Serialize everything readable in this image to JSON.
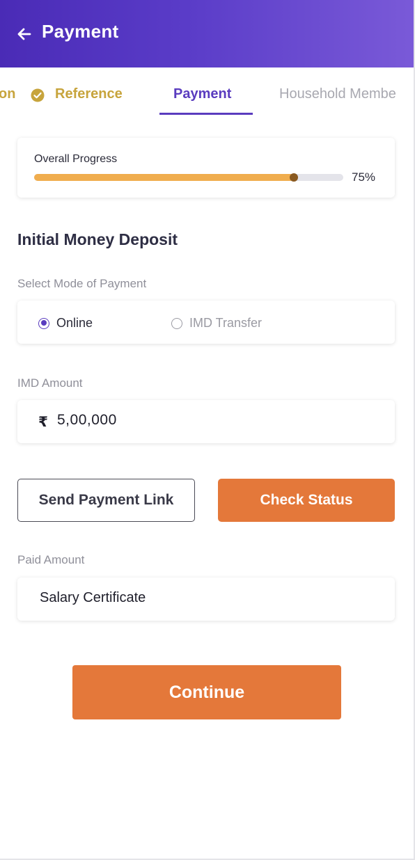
{
  "header": {
    "title": "Payment",
    "gradient_start": "#4a2bb6",
    "gradient_end": "#7a5ad8"
  },
  "tabs": [
    {
      "label": "on",
      "state": "done"
    },
    {
      "label": "Reference",
      "state": "done"
    },
    {
      "label": "Payment",
      "state": "active"
    },
    {
      "label": "Household Membe",
      "state": "pending"
    }
  ],
  "progress": {
    "title": "Overall Progress",
    "percent_label": "75%",
    "value": 0.84,
    "fill_color": "#f0ad4e"
  },
  "section": {
    "title": "Initial Money Deposit"
  },
  "payment_mode": {
    "label": "Select Mode of Payment",
    "options": [
      {
        "label": "Online",
        "selected": true
      },
      {
        "label": "IMD Transfer",
        "selected": false
      }
    ]
  },
  "imd_amount": {
    "label": "IMD Amount",
    "currency_symbol": "₹",
    "value": "5,00,000"
  },
  "actions": {
    "send_link_label": "Send Payment Link",
    "check_status_label": "Check Status",
    "accent_color": "#e4783a"
  },
  "paid_amount": {
    "label": "Paid Amount",
    "value": "Salary Certificate"
  },
  "footer": {
    "continue_label": "Continue"
  }
}
